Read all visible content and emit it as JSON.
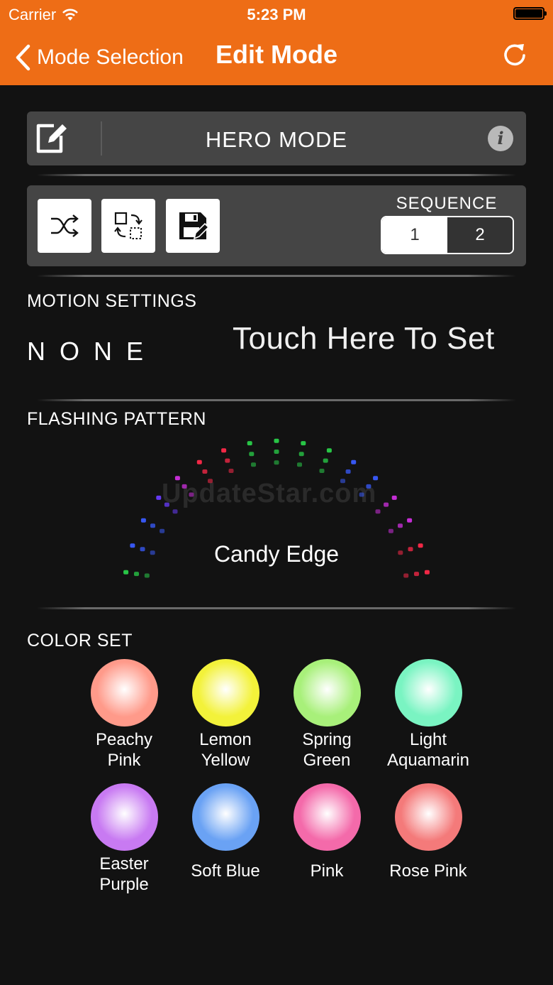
{
  "status_bar": {
    "carrier": "Carrier",
    "time": "5:23 PM"
  },
  "nav": {
    "back_label": "Mode Selection",
    "title": "Edit Mode"
  },
  "mode": {
    "name": "HERO MODE",
    "info_glyph": "i"
  },
  "sequence": {
    "label": "SEQUENCE",
    "options": [
      "1",
      "2"
    ],
    "selected": "1"
  },
  "motion": {
    "label": "MOTION SETTINGS",
    "value": "NONE",
    "touch_hint": "Touch Here To Set"
  },
  "flashing": {
    "label": "FLASHING PATTERN",
    "pattern_name": "Candy Edge",
    "watermark": "UpdateStar.com"
  },
  "color_set": {
    "label": "COLOR SET",
    "colors": [
      {
        "line1": "Peachy",
        "line2": "Pink",
        "color": "#ff9a8a"
      },
      {
        "line1": "Lemon",
        "line2": "Yellow",
        "color": "#f3f23a"
      },
      {
        "line1": "Spring",
        "line2": "Green",
        "color": "#a8f07a"
      },
      {
        "line1": "Light",
        "line2": "Aquamarin",
        "color": "#7af4c2"
      },
      {
        "line1": "Easter",
        "line2": "Purple",
        "color": "#c87af2"
      },
      {
        "line1": "Soft Blue",
        "line2": "",
        "color": "#6aa2f4"
      },
      {
        "line1": "Pink",
        "line2": "",
        "color": "#f46aaa"
      },
      {
        "line1": "Rose Pink",
        "line2": "",
        "color": "#f47a7a"
      }
    ]
  },
  "icons": {
    "edit": "edit-icon",
    "info": "info-icon",
    "shuffle": "shuffle-icon",
    "swap": "swap-icon",
    "save": "save-icon",
    "refresh": "refresh-icon",
    "back": "chevron-left-icon",
    "wifi": "wifi-icon",
    "battery": "battery-icon"
  },
  "colors": {
    "nav_bar": "#ee6d16",
    "background": "#121212",
    "panel": "#454545"
  }
}
